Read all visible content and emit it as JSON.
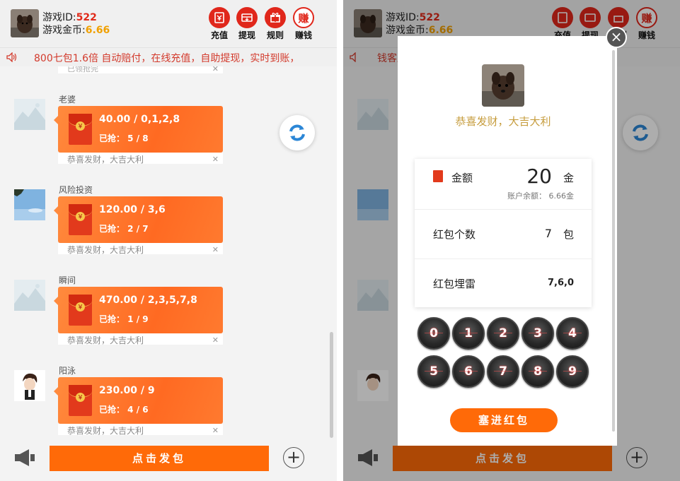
{
  "header": {
    "id_label": "游戏ID:",
    "id_value": "522",
    "gold_label": "游戏金币:",
    "gold_value": "6.66",
    "buttons": [
      {
        "label": "充值",
        "icon": "recharge-icon"
      },
      {
        "label": "提现",
        "icon": "withdraw-icon"
      },
      {
        "label": "规则",
        "icon": "rules-icon"
      },
      {
        "label": "赚钱",
        "icon": "earn-icon",
        "glyph": "赚"
      }
    ]
  },
  "marquee": {
    "left_text": "800七包1.6倍 自动赔付，在线充值，自助提现，实时到账，",
    "right_text": "钱客服"
  },
  "feed": {
    "top_remnant": "已领抢完",
    "messages": [
      {
        "name": "老婆",
        "amount": "40.00 / 0,1,2,8",
        "grab": "已抢：  5 / 8",
        "wish": "恭喜发财，大吉大利",
        "avatar": "mountain-placeholder"
      },
      {
        "name": "风险投资",
        "amount": "120.00 / 3,6",
        "grab": "已抢：  2 / 7",
        "wish": "恭喜发财，大吉大利",
        "avatar": "sky-photo"
      },
      {
        "name": "瞬间",
        "amount": "470.00 / 2,3,5,7,8",
        "grab": "已抢：  1 / 9",
        "wish": "恭喜发财，大吉大利",
        "avatar": "mountain-placeholder"
      },
      {
        "name": "阳泳",
        "amount": "230.00 / 9",
        "grab": "已抢：  4 / 6",
        "wish": "恭喜发财，大吉大利",
        "avatar": "cartoon-character"
      }
    ],
    "coin_glyph": "￥"
  },
  "bottom": {
    "send_label": "点击发包"
  },
  "modal": {
    "wish": "恭喜发财，大吉大利",
    "amount_label": "金额",
    "amount_value": "20",
    "amount_unit": "金",
    "balance": "账户余额：  6.66金",
    "count_label": "红包个数",
    "count_value": "7",
    "count_unit": "包",
    "mine_label": "红包埋雷",
    "mine_value": "7,6,0",
    "keys": [
      "0",
      "1",
      "2",
      "3",
      "4",
      "5",
      "6",
      "7",
      "8",
      "9"
    ],
    "submit_label": "塞进红包",
    "close_glyph": "×"
  },
  "colors": {
    "accent": "#ff6a08",
    "red": "#e0271b",
    "gold": "#f0a000",
    "wish_gold": "#c69c3c"
  }
}
